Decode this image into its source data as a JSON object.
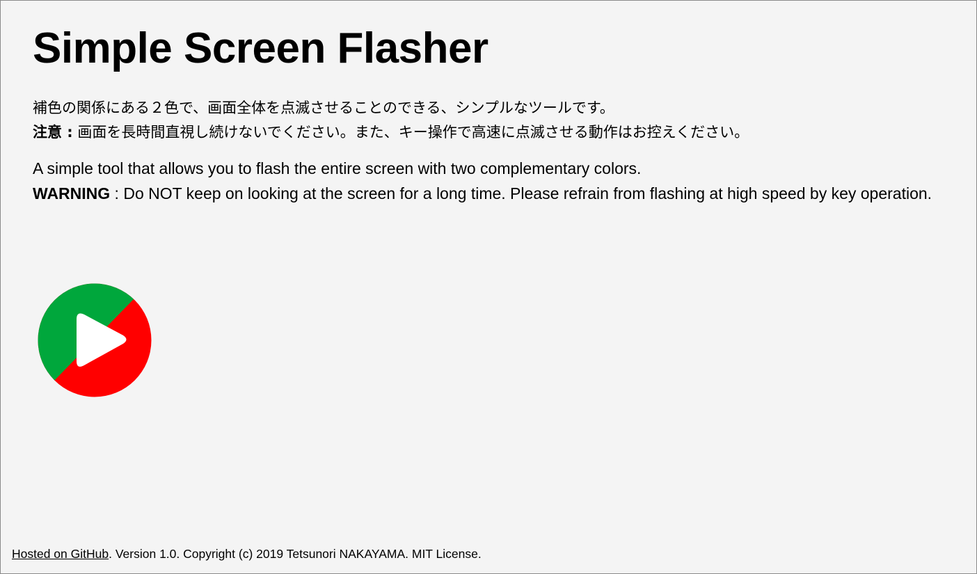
{
  "title": "Simple Screen Flasher",
  "description_ja": {
    "line1": "補色の関係にある２色で、画面全体を点滅させることのできる、シンプルなツールです。",
    "warning_label": "注意 :",
    "warning_text": " 画面を長時間直視し続けないでください。また、キー操作で高速に点滅させる動作はお控えください。"
  },
  "description_en": {
    "line1": "A simple tool that allows you to flash the entire screen with two complementary colors.",
    "warning_label": "WARNING",
    "warning_text": " : Do NOT keep on looking at the screen for a long time. Please refrain from flashing at high speed by key operation."
  },
  "play_button": {
    "icon": "play-icon",
    "colors": {
      "green": "#00a73c",
      "red": "#ff0000",
      "triangle": "#ffffff"
    }
  },
  "footer": {
    "link_text": "Hosted on GitHub",
    "text": ". Version 1.0. Copyright (c) 2019 Tetsunori NAKAYAMA. MIT License."
  }
}
